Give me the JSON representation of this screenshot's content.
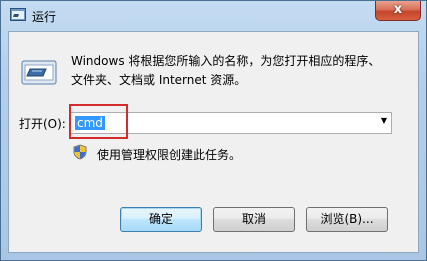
{
  "window": {
    "title": "运行",
    "close_label": "x"
  },
  "dialog": {
    "description_line1": "Windows 将根据您所输入的名称，为您打开相应的程序、",
    "description_line2": "文件夹、文档或 Internet 资源。",
    "open_label": "打开(O):",
    "open_value": "cmd",
    "admin_note": "使用管理权限创建此任务。"
  },
  "buttons": {
    "ok": "确定",
    "cancel": "取消",
    "browse": "浏览(B)..."
  },
  "colors": {
    "highlight_box": "#d62b2b",
    "selection": "#3399ff"
  },
  "icons": {
    "title": "run-app-icon",
    "main": "run-dialog-icon",
    "uac": "uac-shield-icon",
    "dropdown": "chevron-down-icon"
  }
}
